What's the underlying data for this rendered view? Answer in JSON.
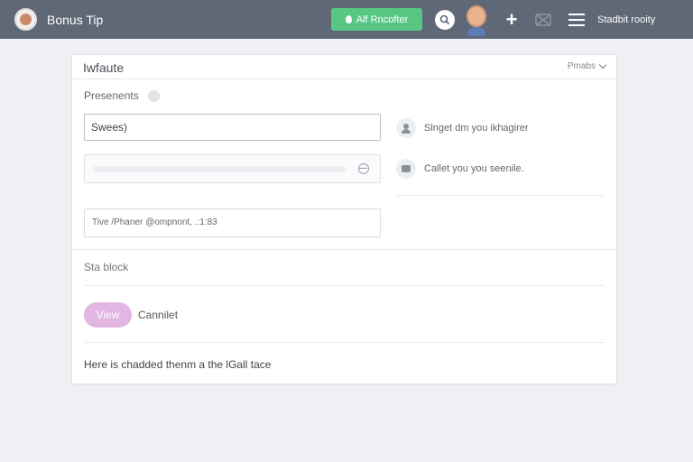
{
  "topbar": {
    "title": "Bonus Tip",
    "add_label": "Alf Rncofter",
    "status": "Stadbit rooity"
  },
  "card": {
    "title": "Iwfaute",
    "header_action": "Pmabs",
    "section_label": "Presenents",
    "primary_input_value": "Swees)",
    "hint_1": "Slnget dm you ikhagirer",
    "hint_2": "Callet you you seenile.",
    "contact_value": "Tive /Phaner @ompnont, .:1:83",
    "block_label": "Sta block",
    "view_label": "View",
    "cancel_label": "Cannilet",
    "footer_note": "Here is chadded thenm a the lGall tace"
  },
  "colors": {
    "topbar_bg": "#5f6877",
    "accent_green": "#58c784",
    "view_button": "#e3b5e3"
  },
  "icons": [
    "brand-avatar",
    "add-icon",
    "search-icon",
    "user-avatar",
    "plus-icon",
    "disabled-icon",
    "menu-icon",
    "chevron-down-icon",
    "globe-icon",
    "person-icon",
    "chat-icon"
  ]
}
